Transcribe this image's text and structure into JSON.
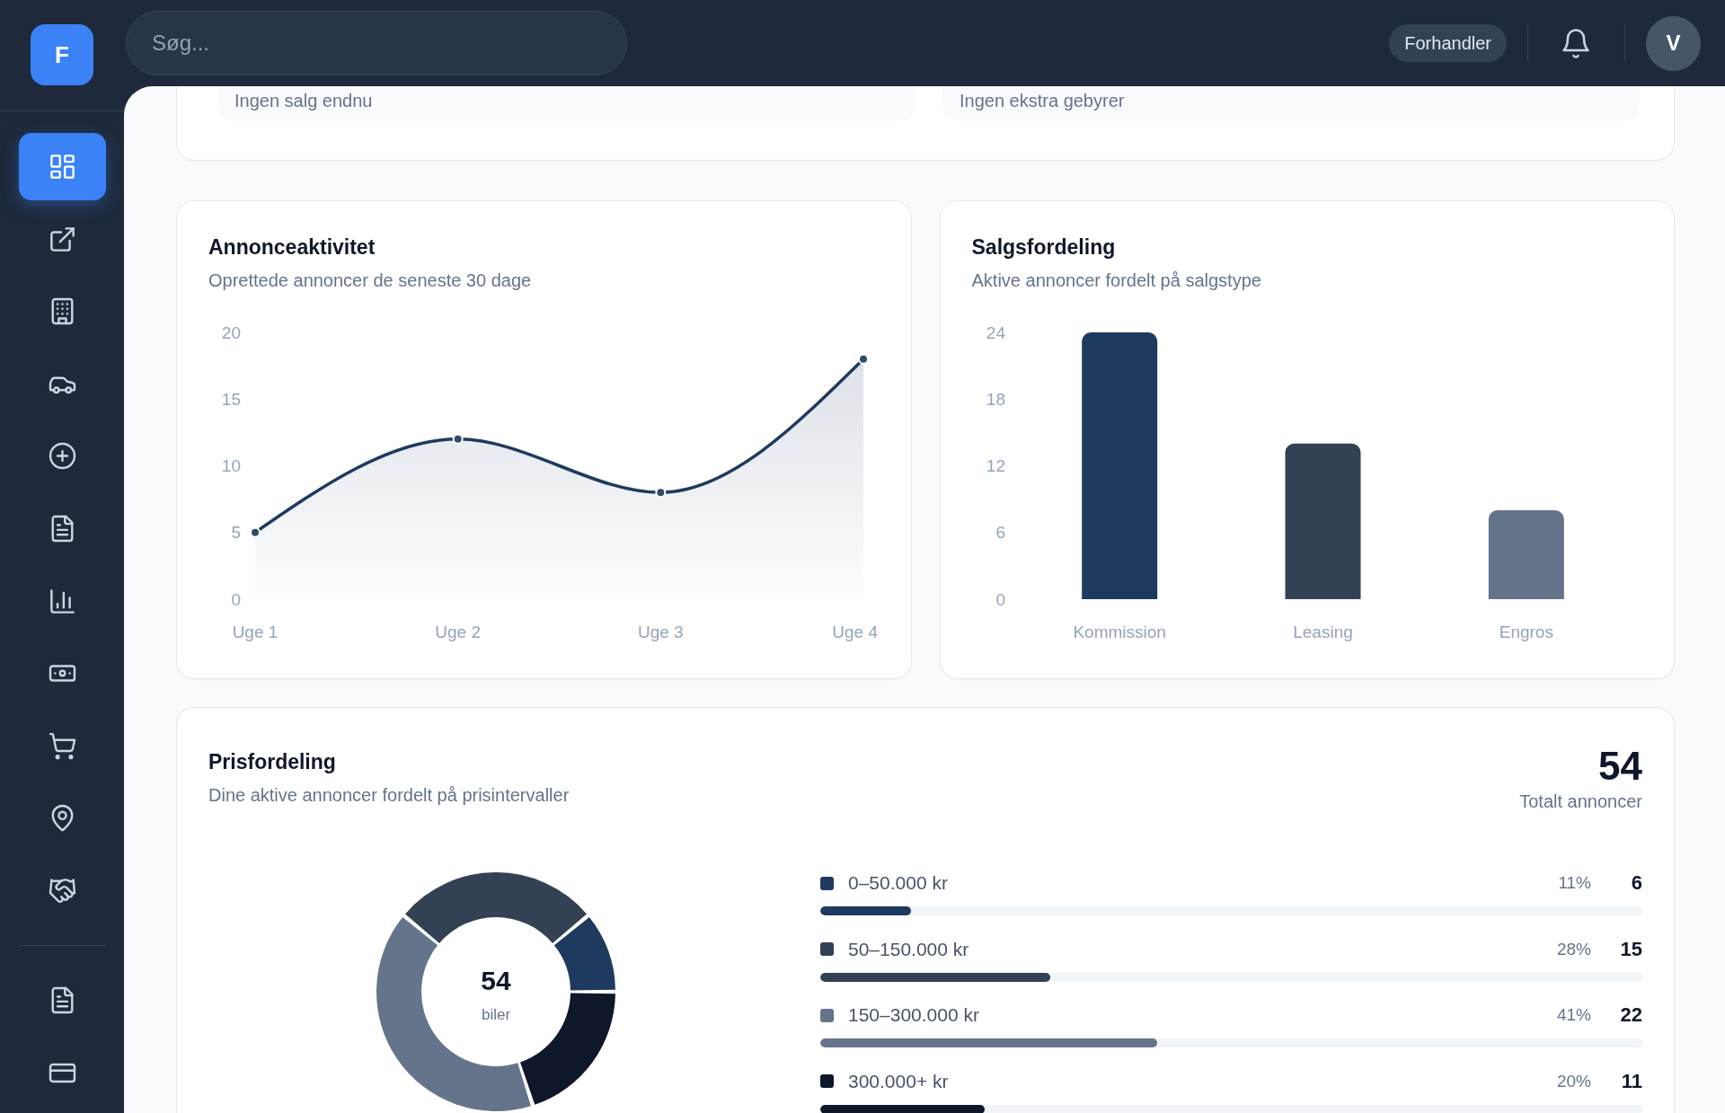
{
  "sidebar": {
    "logo": "F",
    "items": [
      {
        "selected": true
      },
      {
        "selected": false
      },
      {
        "selected": false
      },
      {
        "selected": false
      },
      {
        "selected": false
      },
      {
        "selected": false
      },
      {
        "selected": false
      },
      {
        "selected": false
      },
      {
        "selected": false
      },
      {
        "selected": false
      },
      {
        "selected": false
      }
    ],
    "bottom_items": [
      {
        "selected": false
      },
      {
        "selected": false
      }
    ]
  },
  "topbar": {
    "search": {
      "placeholder": "Søg..."
    },
    "role_badge": "Forhandler",
    "avatar": "V"
  },
  "overview_card": {
    "stat_notes": [
      "Ingen salg endnu",
      "Ingen ekstra gebyrer"
    ]
  },
  "activity_card": {
    "title": "Annonceaktivitet",
    "subtitle": "Oprettede annoncer de seneste 30 dage",
    "chart_data": {
      "type": "area",
      "categories": [
        "Uge 1",
        "Uge 2",
        "Uge 3",
        "Uge 4"
      ],
      "values": [
        5,
        12,
        8,
        18
      ],
      "ylim": [
        0,
        20
      ],
      "yticks": [
        0,
        5,
        10,
        15,
        20
      ]
    }
  },
  "sales_card": {
    "title": "Salgsfordeling",
    "subtitle": "Aktive annoncer fordelt på salgstype",
    "chart_data": {
      "type": "bar",
      "categories": [
        "Kommission",
        "Leasing",
        "Engros"
      ],
      "values": [
        24,
        14,
        8
      ],
      "ylim": [
        0,
        24
      ],
      "yticks": [
        0,
        6,
        12,
        18,
        24
      ]
    }
  },
  "price_card": {
    "title": "Prisfordeling",
    "subtitle": "Dine aktive annoncer fordelt på prisintervaller",
    "total": "54",
    "total_label": "Totalt annoncer",
    "chart_data": {
      "type": "donut",
      "categories": [
        "0–50.000 kr",
        "50–150.000 kr",
        "150–300.000 kr",
        "300.000+ kr"
      ],
      "values": [
        11,
        28,
        41,
        20
      ]
    },
    "center_value": "54",
    "center_label": "biler",
    "ranges": [
      {
        "color": "#1e3a5f",
        "percent": "11%",
        "count": "6",
        "level": 0.11
      },
      {
        "color": "#334155",
        "percent": "28%",
        "count": "15",
        "level": 0.28
      },
      {
        "color": "#64748b",
        "percent": "41%",
        "count": "22",
        "level": 0.41
      },
      {
        "color": "#0f172a",
        "percent": "20%",
        "count": "11",
        "level": 0.2
      }
    ]
  }
}
